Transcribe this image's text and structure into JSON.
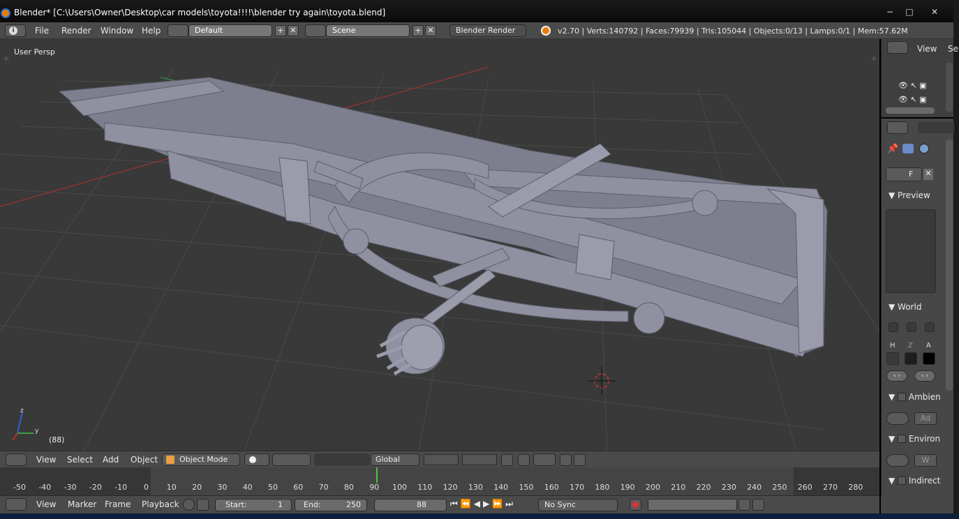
{
  "window": {
    "title": "Blender* [C:\\Users\\Owner\\Desktop\\car models\\toyota!!!!\\blender try again\\toyota.blend]",
    "controls": [
      "−",
      "□",
      "✕"
    ]
  },
  "info_header": {
    "menus": [
      "File",
      "Render",
      "Window",
      "Help"
    ],
    "screen_layout": "Default",
    "scene": "Scene",
    "render_engine": "Blender Render",
    "stats": "v2.70 | Verts:140792 | Faces:79939 | Tris:105044 | Objects:0/13 | Lamps:0/1 | Mem:57.62M"
  },
  "viewport": {
    "view_name": "User Persp",
    "frame_label": "(88)",
    "axes": [
      "z",
      "y"
    ],
    "colors": {
      "background": "#393939",
      "x_axis": "#b03030",
      "y_axis": "#3aa040",
      "mesh": "#8f90a0"
    }
  },
  "outliner": {
    "view_label": "View",
    "cut_label": "Se"
  },
  "properties": {
    "preview_label": "Preview",
    "world_label": "World",
    "hza_labels": [
      "H",
      "Z",
      "A"
    ],
    "ambient_label": "Ambien",
    "ambient_field": "Ad",
    "environment_label": "Environ",
    "environment_field": "W",
    "indirect_label": "Indirect",
    "data_field_f": "F"
  },
  "view3d_header": {
    "menus": [
      "View",
      "Select",
      "Add",
      "Object"
    ],
    "mode": "Object Mode",
    "orientation": "Global"
  },
  "timeline": {
    "ticks": [
      "-50",
      "-40",
      "-30",
      "-20",
      "-10",
      "0",
      "10",
      "20",
      "30",
      "40",
      "50",
      "60",
      "70",
      "80",
      "90",
      "100",
      "110",
      "120",
      "130",
      "140",
      "150",
      "160",
      "170",
      "180",
      "190",
      "200",
      "210",
      "220",
      "230",
      "240",
      "250",
      "260",
      "270",
      "280"
    ],
    "current_frame_marker": 88
  },
  "timeline_header": {
    "menus": [
      "View",
      "Marker",
      "Frame",
      "Playback"
    ],
    "start_label": "Start:",
    "start_value": "1",
    "end_label": "End:",
    "end_value": "250",
    "current_value": "88",
    "sync": "No Sync"
  }
}
